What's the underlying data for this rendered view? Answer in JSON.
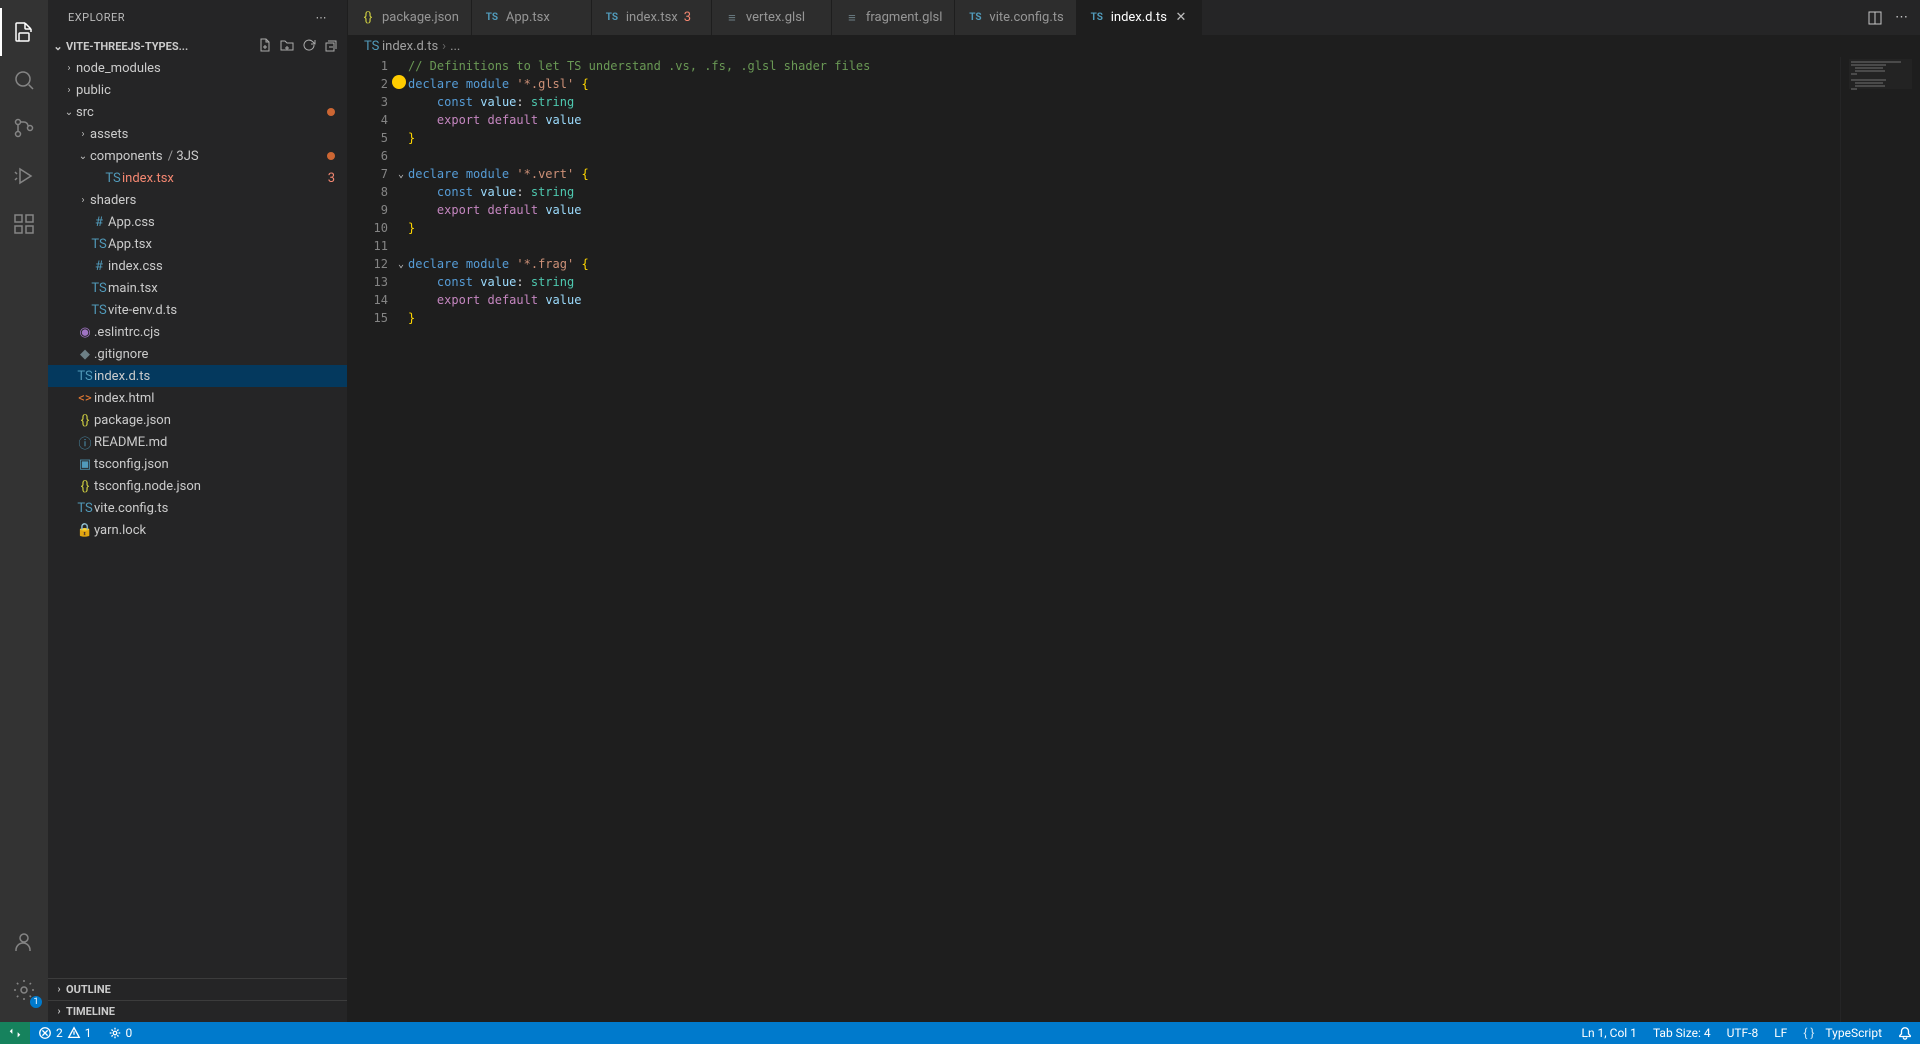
{
  "sidebar_title": "Explorer",
  "project_name": "VITE-THREEJS-TYPES...",
  "tree": {
    "node_modules": "node_modules",
    "public": "public",
    "src": "src",
    "assets": "assets",
    "components": "components",
    "three_js": "3JS",
    "index_tsx": "index.tsx",
    "index_tsx_badge": "3",
    "shaders": "shaders",
    "app_css": "App.css",
    "app_tsx": "App.tsx",
    "index_css": "index.css",
    "main_tsx": "main.tsx",
    "vite_env": "vite-env.d.ts",
    "eslintrc": ".eslintrc.cjs",
    "gitignore": ".gitignore",
    "index_d_ts": "index.d.ts",
    "index_html": "index.html",
    "package_json": "package.json",
    "readme": "README.md",
    "tsconfig": "tsconfig.json",
    "tsconfig_node": "tsconfig.node.json",
    "vite_config": "vite.config.ts",
    "yarn_lock": "yarn.lock"
  },
  "sections": {
    "outline": "Outline",
    "timeline": "Timeline"
  },
  "tabs": [
    {
      "label": "package.json",
      "icon": "json"
    },
    {
      "label": "App.tsx",
      "icon": "ts"
    },
    {
      "label": "index.tsx",
      "icon": "ts",
      "badge": "3"
    },
    {
      "label": "vertex.glsl",
      "icon": "glsl"
    },
    {
      "label": "fragment.glsl",
      "icon": "glsl"
    },
    {
      "label": "vite.config.ts",
      "icon": "ts"
    },
    {
      "label": "index.d.ts",
      "icon": "ts",
      "active": true
    }
  ],
  "breadcrumb": {
    "file": "index.d.ts",
    "rest": "..."
  },
  "code_lines": [
    {
      "n": 1,
      "html": "<span class='tok-comment'>// Definitions to let TS understand .vs, .fs, .glsl shader files</span>"
    },
    {
      "n": 2,
      "fold": true,
      "bulb": true,
      "html": "<span class='tok-keyword'>declare</span> <span class='tok-keyword'>module</span> <span class='tok-string'>'*.glsl'</span> <span class='tok-paren'>{</span>"
    },
    {
      "n": 3,
      "html": "    <span class='tok-keyword'>const</span> <span class='tok-ident'>value</span><span class='tok-punc'>:</span> <span class='tok-type'>string</span>"
    },
    {
      "n": 4,
      "html": "    <span class='tok-export'>export</span> <span class='tok-export'>default</span> <span class='tok-ident'>value</span>"
    },
    {
      "n": 5,
      "html": "<span class='tok-paren'>}</span>"
    },
    {
      "n": 6,
      "html": ""
    },
    {
      "n": 7,
      "fold": true,
      "html": "<span class='tok-keyword'>declare</span> <span class='tok-keyword'>module</span> <span class='tok-string'>'*.vert'</span> <span class='tok-paren'>{</span>"
    },
    {
      "n": 8,
      "html": "    <span class='tok-keyword'>const</span> <span class='tok-ident'>value</span><span class='tok-punc'>:</span> <span class='tok-type'>string</span>"
    },
    {
      "n": 9,
      "html": "    <span class='tok-export'>export</span> <span class='tok-export'>default</span> <span class='tok-ident'>value</span>"
    },
    {
      "n": 10,
      "html": "<span class='tok-paren'>}</span>"
    },
    {
      "n": 11,
      "html": ""
    },
    {
      "n": 12,
      "fold": true,
      "html": "<span class='tok-keyword'>declare</span> <span class='tok-keyword'>module</span> <span class='tok-string'>'*.frag'</span> <span class='tok-paren'>{</span>"
    },
    {
      "n": 13,
      "html": "    <span class='tok-keyword'>const</span> <span class='tok-ident'>value</span><span class='tok-punc'>:</span> <span class='tok-type'>string</span>"
    },
    {
      "n": 14,
      "html": "    <span class='tok-export'>export</span> <span class='tok-export'>default</span> <span class='tok-ident'>value</span>"
    },
    {
      "n": 15,
      "html": "<span class='tok-paren'>}</span>"
    }
  ],
  "status": {
    "errors": "2",
    "warnings": "1",
    "ports": "0",
    "cursor": "Ln 1, Col 1",
    "tab_size": "Tab Size: 4",
    "encoding": "UTF-8",
    "eol": "LF",
    "lang": "TypeScript"
  }
}
